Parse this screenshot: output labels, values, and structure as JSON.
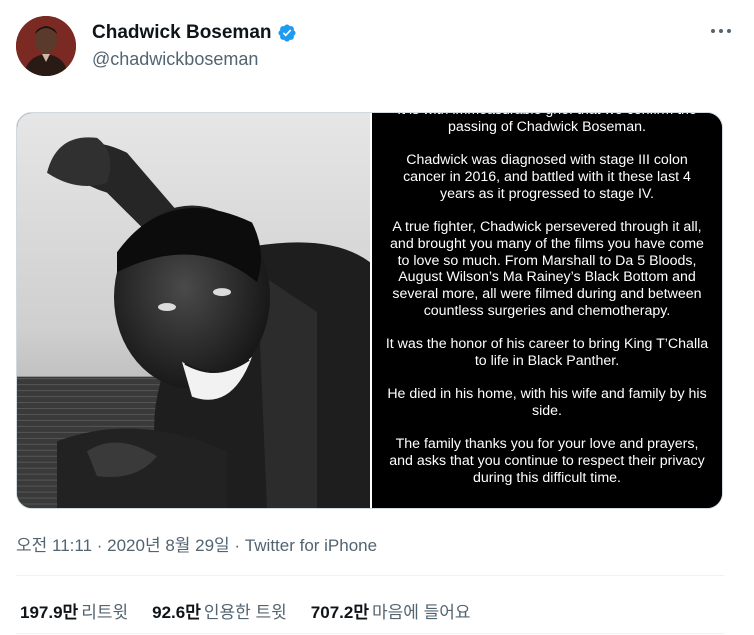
{
  "author": {
    "name": "Chadwick Boseman",
    "handle": "@chadwickboseman"
  },
  "statement": {
    "paragraphs": [
      "It is with immeasurable grief that we confirm the passing of Chadwick Boseman.",
      "Chadwick was diagnosed with stage III colon cancer in 2016, and battled with it these last 4 years as it progressed to stage IV.",
      "A true fighter, Chadwick persevered through it all, and brought you many of the films you have come to love so much. From Marshall to Da 5 Bloods, August Wilson’s Ma Rainey’s Black Bottom and several more, all were filmed during and between countless surgeries and chemotherapy.",
      "It was the honor of his career to bring King T’Challa to life in Black Panther.",
      "He died in his home, with his wife and family by his side.",
      "The family thanks you for your love and prayers, and asks that you continue to respect their privacy during this difficult time."
    ]
  },
  "meta": {
    "time": "오전 11:11",
    "separator": " · ",
    "date": "2020년 8월 29일",
    "source": "Twitter for iPhone"
  },
  "stats": {
    "retweets": {
      "value": "197.9만",
      "label": "리트윗"
    },
    "quotes": {
      "value": "92.6만",
      "label": "인용한 트윗"
    },
    "likes": {
      "value": "707.2만",
      "label": "마음에 들어요"
    }
  },
  "colors": {
    "verified": "#1d9bf0",
    "secondary_text": "#536471",
    "primary_text": "#0f1419"
  },
  "icons": {
    "verified": "verified-badge-icon",
    "more": "more-dots-icon"
  }
}
